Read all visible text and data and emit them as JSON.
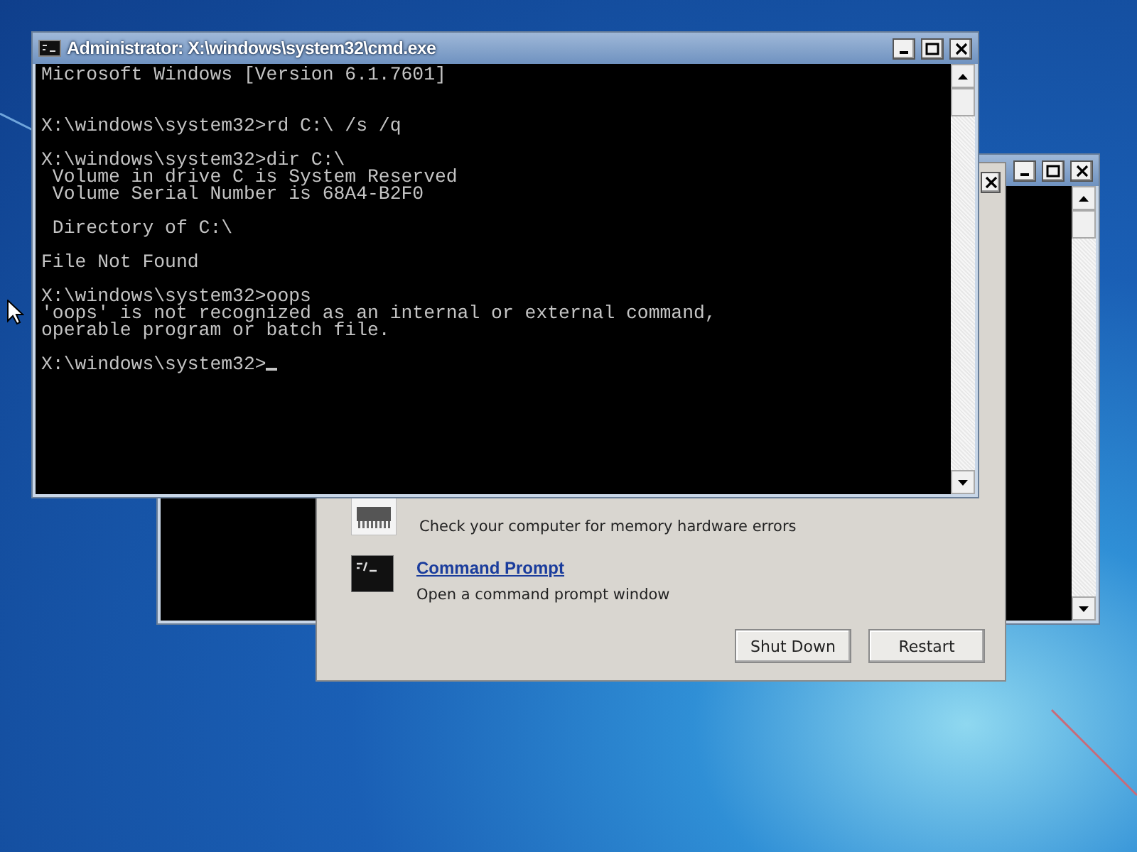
{
  "back_window": {
    "kind": "console"
  },
  "recovery_dialog": {
    "items": [
      {
        "kind": "memory",
        "description": "Check your computer for memory hardware errors"
      },
      {
        "kind": "console",
        "link": "Command Prompt",
        "description": "Open a command prompt window"
      }
    ],
    "buttons": [
      "Shut Down",
      "Restart"
    ]
  },
  "cmd_window": {
    "title": "Administrator: X:\\windows\\system32\\cmd.exe",
    "banner": "Microsoft Windows [Version 6.1.7601]",
    "blocks": [
      [
        "X:\\windows\\system32>rd C:\\ /s /q"
      ],
      [
        "X:\\windows\\system32>dir C:\\",
        " Volume in drive C is System Reserved",
        " Volume Serial Number is 68A4-B2F0"
      ],
      [
        " Directory of C:\\"
      ],
      [
        "File Not Found"
      ],
      [
        "X:\\windows\\system32>oops",
        "'oops' is not recognized as an internal or external command,",
        "operable program or batch file."
      ],
      [
        "X:\\windows\\system32>"
      ]
    ],
    "cursor": true
  }
}
